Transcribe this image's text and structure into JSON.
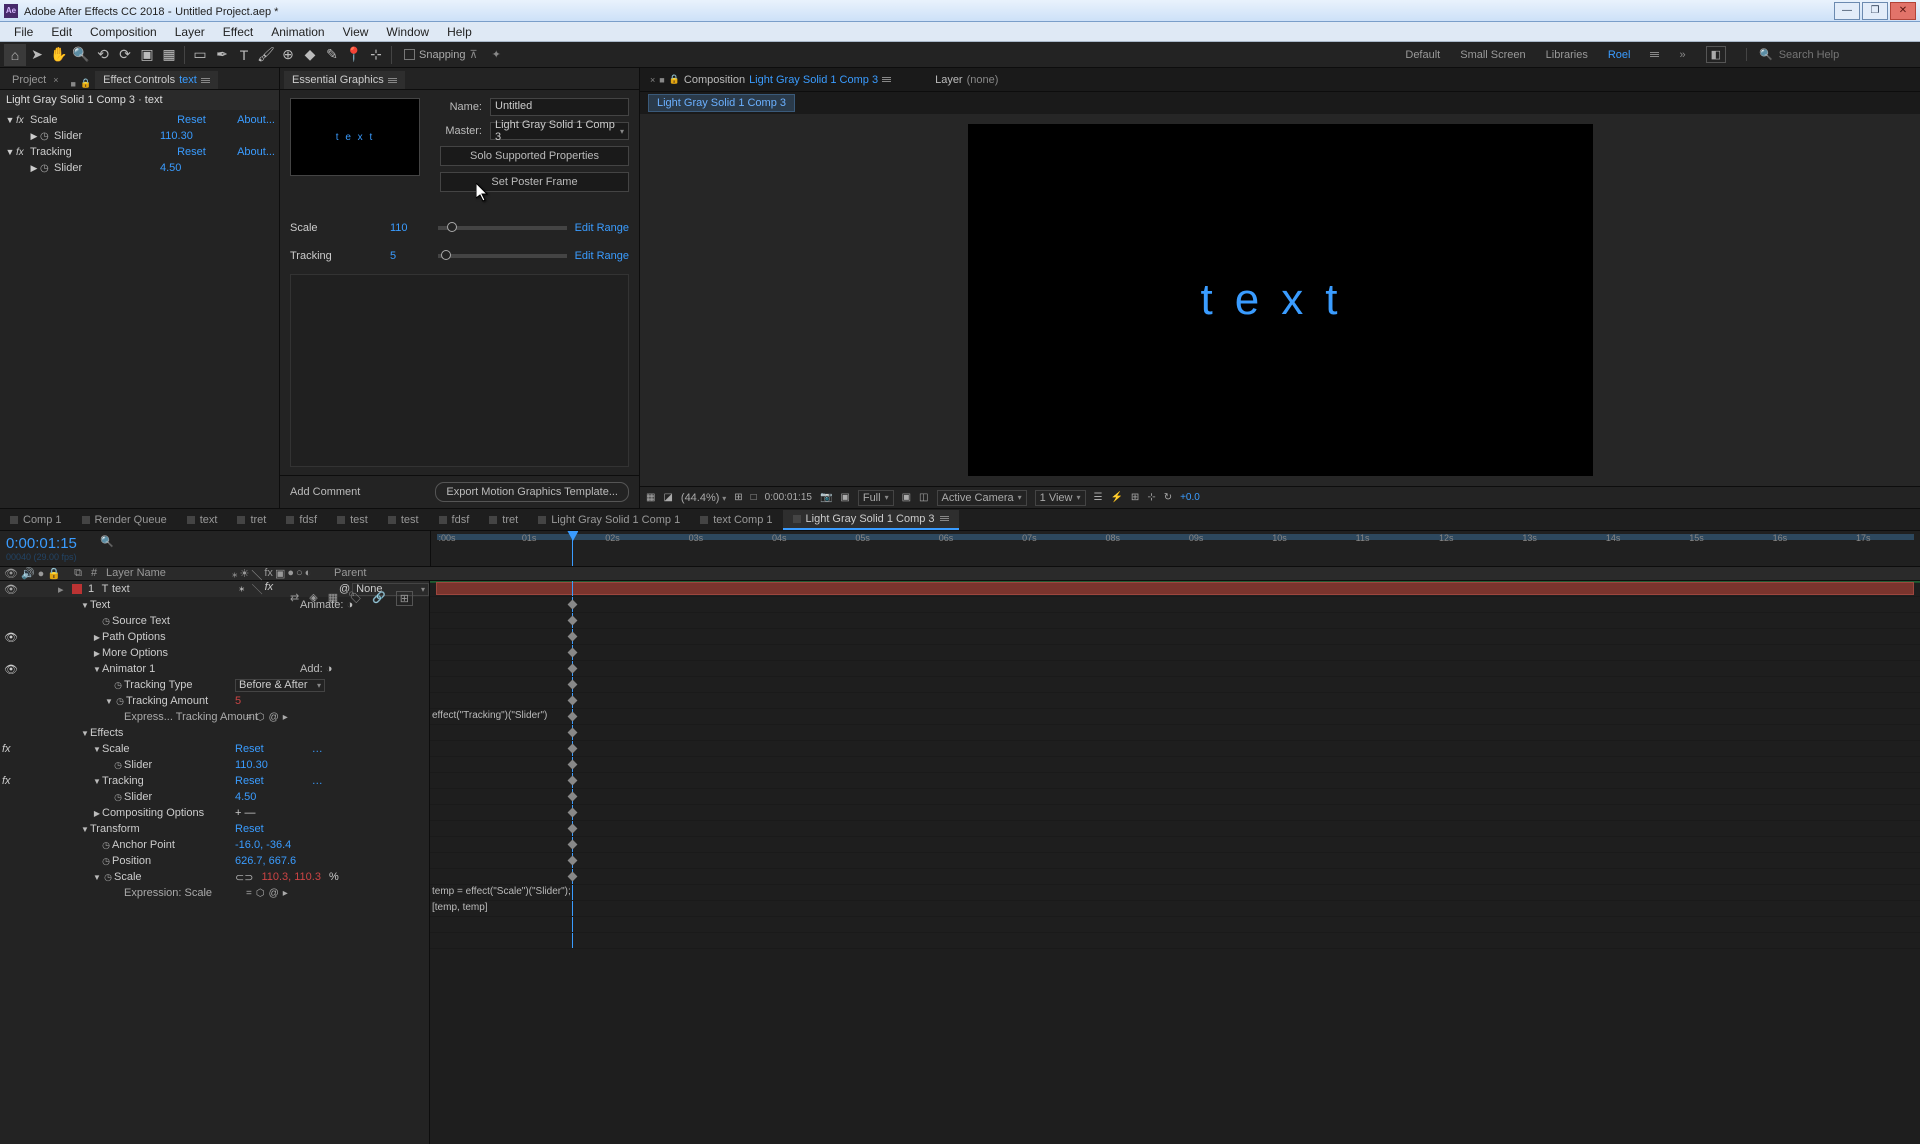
{
  "titlebar": {
    "app": "Adobe After Effects CC 2018",
    "project": "Untitled Project.aep *"
  },
  "menubar": [
    "File",
    "Edit",
    "Composition",
    "Layer",
    "Effect",
    "Animation",
    "View",
    "Window",
    "Help"
  ],
  "toolbar": {
    "snapping": "Snapping",
    "workspaces": [
      "Default",
      "Small Screen",
      "Libraries"
    ],
    "ws_active": "Roel",
    "search_placeholder": "Search Help"
  },
  "leftpanel": {
    "tab_project": "Project",
    "tab_effect": "Effect Controls",
    "tab_effect_item": "text",
    "header": "Light Gray Solid 1 Comp 3 · text",
    "fx": [
      {
        "name": "Scale",
        "reset": "Reset",
        "about": "About...",
        "slider": "Slider",
        "value": "110.30"
      },
      {
        "name": "Tracking",
        "reset": "Reset",
        "about": "About...",
        "slider": "Slider",
        "value": "4.50"
      }
    ]
  },
  "eg": {
    "title": "Essential Graphics",
    "preview": "t e x t",
    "name_label": "Name:",
    "name_value": "Untitled",
    "master_label": "Master:",
    "master_value": "Light Gray Solid 1 Comp 3",
    "solo": "Solo Supported Properties",
    "poster": "Set Poster Frame",
    "props": [
      {
        "name": "Scale",
        "value": "110",
        "handle": 7,
        "edit": "Edit Range"
      },
      {
        "name": "Tracking",
        "value": "5",
        "handle": 2,
        "edit": "Edit Range"
      }
    ],
    "add_comment": "Add Comment",
    "export": "Export Motion Graphics Template..."
  },
  "comp": {
    "label": "Composition",
    "name": "Light Gray Solid 1 Comp 3",
    "layer_label": "Layer",
    "layer_value": "(none)",
    "flow_item": "Light Gray Solid 1 Comp 3",
    "canvas_text": "text",
    "controls": {
      "zoom": "(44.4%)",
      "time": "0:00:01:15",
      "res": "Full",
      "camera": "Active Camera",
      "views": "1 View",
      "exposure": "+0.0"
    }
  },
  "tl": {
    "tabs": [
      "Comp 1",
      "Render Queue",
      "text",
      "tret",
      "fdsf",
      "test",
      "test",
      "fdsf",
      "tret",
      "Light Gray Solid 1 Comp 1",
      "text Comp 1",
      "Light Gray Solid 1 Comp 3"
    ],
    "active_tab": 11,
    "timecode": "0:00:01:15",
    "frames": "00040 (29.00 fps)",
    "ticks": [
      ":00s",
      "01s",
      "02s",
      "03s",
      "04s",
      "05s",
      "06s",
      "07s",
      "08s",
      "09s",
      "10s",
      "11s",
      "12s",
      "13s",
      "14s",
      "15s",
      "16s",
      "17s"
    ],
    "playhead_pct": 9.5,
    "col_num": "#",
    "col_layer": "Layer Name",
    "col_parent": "Parent",
    "layer": {
      "num": "1",
      "type": "T",
      "name": "text",
      "parent": "None"
    },
    "animate": "Animate:",
    "add": "Add:",
    "before_after": "Before & After",
    "props": {
      "text": "Text",
      "source_text": "Source Text",
      "path_options": "Path Options",
      "more_options": "More Options",
      "animator1": "Animator 1",
      "tracking_type": "Tracking Type",
      "tracking_amount": "Tracking Amount",
      "tracking_amount_val": "5",
      "expr_tracking": "Express... Tracking Amount",
      "effects": "Effects",
      "scale": "Scale",
      "slider": "Slider",
      "scale_val": "110.30",
      "tracking": "Tracking",
      "tracking_val": "4.50",
      "comp_options": "Compositing Options",
      "transform": "Transform",
      "anchor": "Anchor Point",
      "anchor_val": "-16.0, -36.4",
      "position": "Position",
      "position_val": "626.7, 667.6",
      "scale2": "Scale",
      "scale2_val": "110.3, 110.3",
      "scale2_unit": "%",
      "expr_scale": "Expression: Scale",
      "reset": "Reset"
    },
    "track_exprs": {
      "tracking": "effect(\"Tracking\")(\"Slider\")",
      "scale1": "temp = effect(\"Scale\")(\"Slider\");",
      "scale2": "[temp, temp]"
    }
  }
}
